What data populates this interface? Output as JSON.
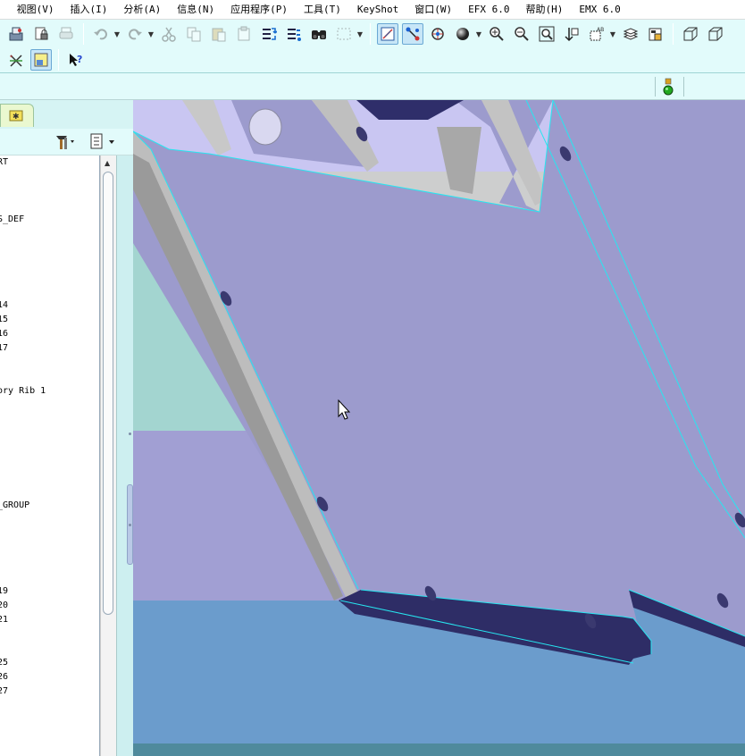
{
  "menu": {
    "items": [
      {
        "label": ")"
      },
      {
        "label": "视图(V)"
      },
      {
        "label": "插入(I)"
      },
      {
        "label": "分析(A)"
      },
      {
        "label": "信息(N)"
      },
      {
        "label": "应用程序(P)"
      },
      {
        "label": "工具(T)"
      },
      {
        "label": "KeyShot"
      },
      {
        "label": "窗口(W)"
      },
      {
        "label": "EFX 6.0"
      },
      {
        "label": "帮助(H)"
      },
      {
        "label": "EMX 6.0"
      }
    ]
  },
  "toolbar": {
    "row1_icons": [
      "save-icon",
      "lock-icon",
      "print-icon",
      "undo-icon",
      "redo-icon",
      "cut-icon",
      "copy-icon",
      "paste-icon",
      "paste-special-icon",
      "regenerate-icon",
      "regenerate-manager-icon",
      "find-icon",
      "select-box-icon",
      "datum-display-icon",
      "datum-axis-icon",
      "spin-center-icon",
      "shade-icon",
      "zoom-in-icon",
      "zoom-out-icon",
      "refit-icon",
      "reorient-icon",
      "saved-views-icon",
      "layers-icon",
      "view-manager-icon",
      "wireframe-icon",
      "hidden-line-icon"
    ],
    "row2_icons": [
      "annotation-display-icon",
      "display-style-icon",
      "context-help-icon"
    ]
  },
  "status": {
    "light_color": "#22aa22"
  },
  "model_tree": {
    "items": [
      {
        "label": "RT"
      },
      {
        "label": "S_DEF"
      },
      {
        "label": "14"
      },
      {
        "label": "15"
      },
      {
        "label": "16"
      },
      {
        "label": "17"
      },
      {
        "label": "ory Rib 1"
      },
      {
        "label": "_GROUP"
      },
      {
        "label": "19"
      },
      {
        "label": "20"
      },
      {
        "label": "21"
      },
      {
        "label": "25"
      },
      {
        "label": "26"
      },
      {
        "label": "27"
      }
    ]
  },
  "viewport": {
    "background_bands": [
      "#c9c6f2",
      "#cdcece",
      "#a3d5d0",
      "#a19fd3",
      "#6b9ccc",
      "#5f94c4"
    ],
    "plate_color": "#9c9bcd",
    "edge_highlight": "#27e6f0",
    "rim_color": "#bdbdbd"
  }
}
